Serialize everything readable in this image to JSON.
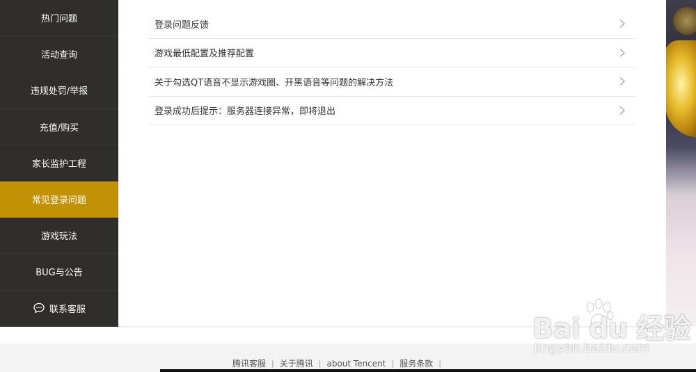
{
  "sidebar": {
    "items": [
      {
        "label": "热门问题"
      },
      {
        "label": "活动查询"
      },
      {
        "label": "违规处罚/举报"
      },
      {
        "label": "充值/购买"
      },
      {
        "label": "家长监护工程"
      },
      {
        "label": "常见登录问题",
        "active": true
      },
      {
        "label": "游戏玩法"
      },
      {
        "label": "BUG与公告"
      },
      {
        "label": "联系客服",
        "icon": "chat-bubble-icon"
      }
    ]
  },
  "questions": [
    {
      "text": "登录问题反馈"
    },
    {
      "text": "游戏最低配置及推荐配置"
    },
    {
      "text": "关于勾选QT语音不显示游戏圈、开黑语音等问题的解决方法"
    },
    {
      "text": "登录成功后提示：服务器连接异常，即将退出"
    }
  ],
  "footer": {
    "links": [
      "腾讯客服",
      "关于腾讯",
      "about Tencent",
      "服务条款"
    ]
  },
  "watermark": {
    "logo": "Bai du 经验",
    "url": "jingyan.baidu.com"
  },
  "colors": {
    "sidebar_bg": "#2f2e2c",
    "active_bg": "#c29106",
    "text": "#333333"
  }
}
